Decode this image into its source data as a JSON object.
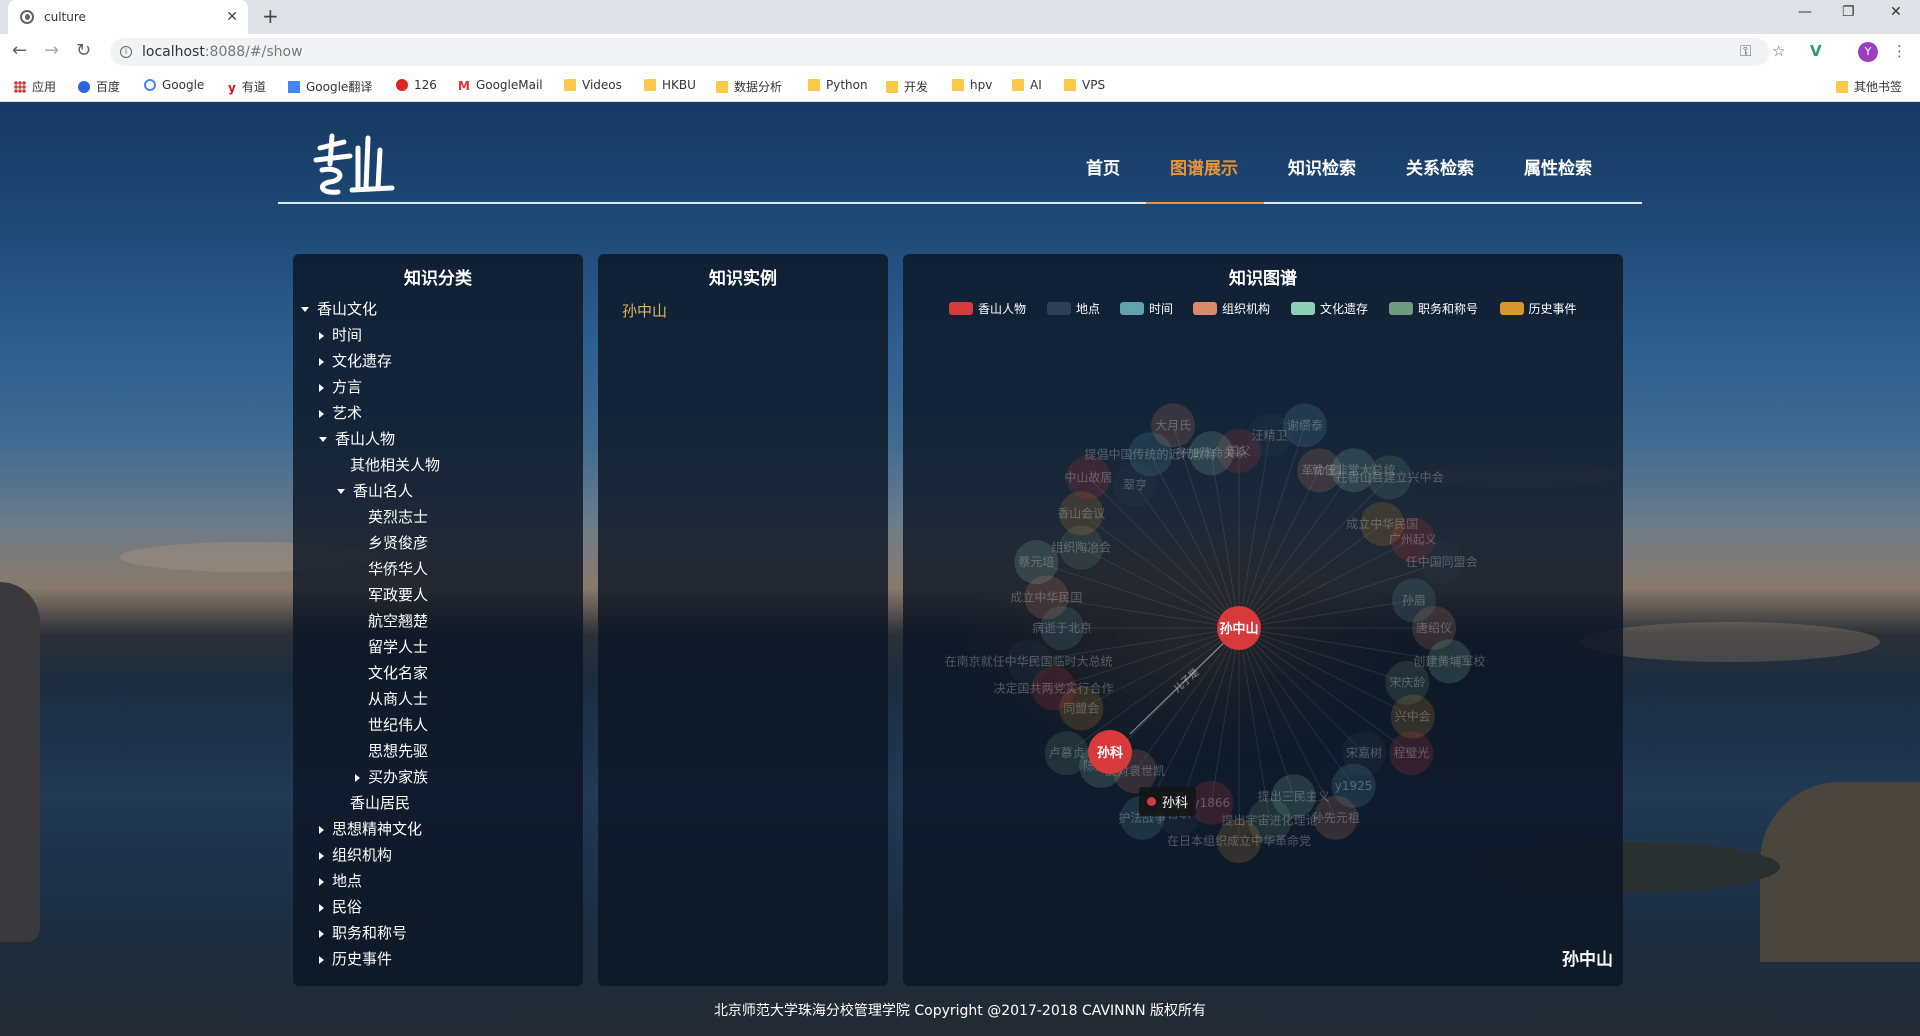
{
  "browser": {
    "tab_title": "culture",
    "url_host": "localhost",
    "url_rest": ":8088/#/show",
    "avatar_letter": "Y",
    "bookmarks": [
      "应用",
      "百度",
      "Google",
      "有道",
      "Google翻译",
      "126",
      "GoogleMail",
      "Videos",
      "HKBU",
      "数据分析",
      "Python",
      "开发",
      "hpv",
      "AI",
      "VPS",
      "其他书签"
    ]
  },
  "header": {
    "menu": [
      "首页",
      "图谱展示",
      "知识检索",
      "关系检索",
      "属性检索"
    ],
    "active_index": 1,
    "accent": "#e3953b"
  },
  "left_panel": {
    "title": "知识分类",
    "tree": [
      {
        "label": "香山文化",
        "level": 0,
        "arrow": "down"
      },
      {
        "label": "时间",
        "level": 1,
        "arrow": "right"
      },
      {
        "label": "文化遗存",
        "level": 1,
        "arrow": "right"
      },
      {
        "label": "方言",
        "level": 1,
        "arrow": "right"
      },
      {
        "label": "艺术",
        "level": 1,
        "arrow": "right"
      },
      {
        "label": "香山人物",
        "level": 1,
        "arrow": "down"
      },
      {
        "label": "其他相关人物",
        "level": 2,
        "arrow": ""
      },
      {
        "label": "香山名人",
        "level": 2,
        "arrow": "down"
      },
      {
        "label": "英烈志士",
        "level": 3,
        "arrow": ""
      },
      {
        "label": "乡贤俊彦",
        "level": 3,
        "arrow": ""
      },
      {
        "label": "华侨华人",
        "level": 3,
        "arrow": ""
      },
      {
        "label": "军政要人",
        "level": 3,
        "arrow": ""
      },
      {
        "label": "航空翘楚",
        "level": 3,
        "arrow": ""
      },
      {
        "label": "留学人士",
        "level": 3,
        "arrow": ""
      },
      {
        "label": "文化名家",
        "level": 3,
        "arrow": ""
      },
      {
        "label": "从商人士",
        "level": 3,
        "arrow": ""
      },
      {
        "label": "世纪伟人",
        "level": 3,
        "arrow": ""
      },
      {
        "label": "思想先驱",
        "level": 3,
        "arrow": ""
      },
      {
        "label": "买办家族",
        "level": 3,
        "arrow": "right"
      },
      {
        "label": "香山居民",
        "level": 2,
        "arrow": ""
      },
      {
        "label": "思想精神文化",
        "level": 1,
        "arrow": "right"
      },
      {
        "label": "组织机构",
        "level": 1,
        "arrow": "right"
      },
      {
        "label": "地点",
        "level": 1,
        "arrow": "right"
      },
      {
        "label": "民俗",
        "level": 1,
        "arrow": "right"
      },
      {
        "label": "职务和称号",
        "level": 1,
        "arrow": "right"
      },
      {
        "label": "历史事件",
        "level": 1,
        "arrow": "right"
      }
    ]
  },
  "middle_panel": {
    "title": "知识实例",
    "selected": "孙中山"
  },
  "right_panel": {
    "title": "知识图谱",
    "legend": [
      {
        "name": "香山人物",
        "color": "#d8393a"
      },
      {
        "name": "地点",
        "color": "#2f4054"
      },
      {
        "name": "时间",
        "color": "#5fa3ad"
      },
      {
        "name": "组织机构",
        "color": "#d98a6c"
      },
      {
        "name": "文化遗存",
        "color": "#8fcfb5"
      },
      {
        "name": "职务和称号",
        "color": "#6f9a82"
      },
      {
        "name": "历史事件",
        "color": "#d9962c"
      }
    ],
    "center_node": "孙中山",
    "highlight_node": "孙科",
    "edge_label": "儿子是",
    "tooltip": "孙科",
    "graph_name": "孙中山",
    "faded_labels": [
      "国父",
      "汪精卫",
      "谢缵泰",
      "革命家",
      "就任非常大总统",
      "在香山县建立兴中会",
      "成立中华民国",
      "广州起义",
      "任中国同盟会",
      "孙眉",
      "唐绍仪",
      "创建黄埔军校",
      "宋庆龄",
      "兴中会",
      "程璧光",
      "宋嘉树",
      "y1925",
      "孙先元祖",
      "提出三民主义",
      "提出宇宙进化理论",
      "在日本组织成立中华革命党",
      "y1866",
      "官职",
      "护法战争",
      "反对袁世凯",
      "陈炯明",
      "卢慕贞",
      "同盟会",
      "决定国共两党实行合作",
      "在南京就任中华民国临时大总统",
      "病逝于北京",
      "成立中华民国",
      "蔡元培",
      "组织陶冶会",
      "香山会议",
      "中山故居",
      "翠亨",
      "提倡中国传统的近代教育",
      "大月氏",
      "参加革命关系"
    ]
  },
  "footer": "北京师范大学珠海分校管理学院 Copyright @2017-2018 CAVINNN 版权所有"
}
